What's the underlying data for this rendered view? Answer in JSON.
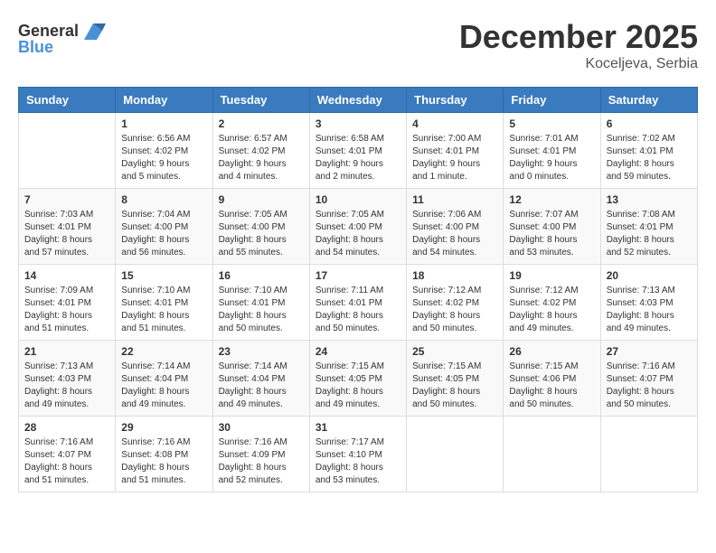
{
  "logo": {
    "general": "General",
    "blue": "Blue"
  },
  "title": {
    "month": "December 2025",
    "location": "Koceljeva, Serbia"
  },
  "weekdays": [
    "Sunday",
    "Monday",
    "Tuesday",
    "Wednesday",
    "Thursday",
    "Friday",
    "Saturday"
  ],
  "weeks": [
    [
      {
        "day": "",
        "sunrise": "",
        "sunset": "",
        "daylight": ""
      },
      {
        "day": "1",
        "sunrise": "Sunrise: 6:56 AM",
        "sunset": "Sunset: 4:02 PM",
        "daylight": "Daylight: 9 hours and 5 minutes."
      },
      {
        "day": "2",
        "sunrise": "Sunrise: 6:57 AM",
        "sunset": "Sunset: 4:02 PM",
        "daylight": "Daylight: 9 hours and 4 minutes."
      },
      {
        "day": "3",
        "sunrise": "Sunrise: 6:58 AM",
        "sunset": "Sunset: 4:01 PM",
        "daylight": "Daylight: 9 hours and 2 minutes."
      },
      {
        "day": "4",
        "sunrise": "Sunrise: 7:00 AM",
        "sunset": "Sunset: 4:01 PM",
        "daylight": "Daylight: 9 hours and 1 minute."
      },
      {
        "day": "5",
        "sunrise": "Sunrise: 7:01 AM",
        "sunset": "Sunset: 4:01 PM",
        "daylight": "Daylight: 9 hours and 0 minutes."
      },
      {
        "day": "6",
        "sunrise": "Sunrise: 7:02 AM",
        "sunset": "Sunset: 4:01 PM",
        "daylight": "Daylight: 8 hours and 59 minutes."
      }
    ],
    [
      {
        "day": "7",
        "sunrise": "Sunrise: 7:03 AM",
        "sunset": "Sunset: 4:01 PM",
        "daylight": "Daylight: 8 hours and 57 minutes."
      },
      {
        "day": "8",
        "sunrise": "Sunrise: 7:04 AM",
        "sunset": "Sunset: 4:00 PM",
        "daylight": "Daylight: 8 hours and 56 minutes."
      },
      {
        "day": "9",
        "sunrise": "Sunrise: 7:05 AM",
        "sunset": "Sunset: 4:00 PM",
        "daylight": "Daylight: 8 hours and 55 minutes."
      },
      {
        "day": "10",
        "sunrise": "Sunrise: 7:05 AM",
        "sunset": "Sunset: 4:00 PM",
        "daylight": "Daylight: 8 hours and 54 minutes."
      },
      {
        "day": "11",
        "sunrise": "Sunrise: 7:06 AM",
        "sunset": "Sunset: 4:00 PM",
        "daylight": "Daylight: 8 hours and 54 minutes."
      },
      {
        "day": "12",
        "sunrise": "Sunrise: 7:07 AM",
        "sunset": "Sunset: 4:00 PM",
        "daylight": "Daylight: 8 hours and 53 minutes."
      },
      {
        "day": "13",
        "sunrise": "Sunrise: 7:08 AM",
        "sunset": "Sunset: 4:01 PM",
        "daylight": "Daylight: 8 hours and 52 minutes."
      }
    ],
    [
      {
        "day": "14",
        "sunrise": "Sunrise: 7:09 AM",
        "sunset": "Sunset: 4:01 PM",
        "daylight": "Daylight: 8 hours and 51 minutes."
      },
      {
        "day": "15",
        "sunrise": "Sunrise: 7:10 AM",
        "sunset": "Sunset: 4:01 PM",
        "daylight": "Daylight: 8 hours and 51 minutes."
      },
      {
        "day": "16",
        "sunrise": "Sunrise: 7:10 AM",
        "sunset": "Sunset: 4:01 PM",
        "daylight": "Daylight: 8 hours and 50 minutes."
      },
      {
        "day": "17",
        "sunrise": "Sunrise: 7:11 AM",
        "sunset": "Sunset: 4:01 PM",
        "daylight": "Daylight: 8 hours and 50 minutes."
      },
      {
        "day": "18",
        "sunrise": "Sunrise: 7:12 AM",
        "sunset": "Sunset: 4:02 PM",
        "daylight": "Daylight: 8 hours and 50 minutes."
      },
      {
        "day": "19",
        "sunrise": "Sunrise: 7:12 AM",
        "sunset": "Sunset: 4:02 PM",
        "daylight": "Daylight: 8 hours and 49 minutes."
      },
      {
        "day": "20",
        "sunrise": "Sunrise: 7:13 AM",
        "sunset": "Sunset: 4:03 PM",
        "daylight": "Daylight: 8 hours and 49 minutes."
      }
    ],
    [
      {
        "day": "21",
        "sunrise": "Sunrise: 7:13 AM",
        "sunset": "Sunset: 4:03 PM",
        "daylight": "Daylight: 8 hours and 49 minutes."
      },
      {
        "day": "22",
        "sunrise": "Sunrise: 7:14 AM",
        "sunset": "Sunset: 4:04 PM",
        "daylight": "Daylight: 8 hours and 49 minutes."
      },
      {
        "day": "23",
        "sunrise": "Sunrise: 7:14 AM",
        "sunset": "Sunset: 4:04 PM",
        "daylight": "Daylight: 8 hours and 49 minutes."
      },
      {
        "day": "24",
        "sunrise": "Sunrise: 7:15 AM",
        "sunset": "Sunset: 4:05 PM",
        "daylight": "Daylight: 8 hours and 49 minutes."
      },
      {
        "day": "25",
        "sunrise": "Sunrise: 7:15 AM",
        "sunset": "Sunset: 4:05 PM",
        "daylight": "Daylight: 8 hours and 50 minutes."
      },
      {
        "day": "26",
        "sunrise": "Sunrise: 7:15 AM",
        "sunset": "Sunset: 4:06 PM",
        "daylight": "Daylight: 8 hours and 50 minutes."
      },
      {
        "day": "27",
        "sunrise": "Sunrise: 7:16 AM",
        "sunset": "Sunset: 4:07 PM",
        "daylight": "Daylight: 8 hours and 50 minutes."
      }
    ],
    [
      {
        "day": "28",
        "sunrise": "Sunrise: 7:16 AM",
        "sunset": "Sunset: 4:07 PM",
        "daylight": "Daylight: 8 hours and 51 minutes."
      },
      {
        "day": "29",
        "sunrise": "Sunrise: 7:16 AM",
        "sunset": "Sunset: 4:08 PM",
        "daylight": "Daylight: 8 hours and 51 minutes."
      },
      {
        "day": "30",
        "sunrise": "Sunrise: 7:16 AM",
        "sunset": "Sunset: 4:09 PM",
        "daylight": "Daylight: 8 hours and 52 minutes."
      },
      {
        "day": "31",
        "sunrise": "Sunrise: 7:17 AM",
        "sunset": "Sunset: 4:10 PM",
        "daylight": "Daylight: 8 hours and 53 minutes."
      },
      {
        "day": "",
        "sunrise": "",
        "sunset": "",
        "daylight": ""
      },
      {
        "day": "",
        "sunrise": "",
        "sunset": "",
        "daylight": ""
      },
      {
        "day": "",
        "sunrise": "",
        "sunset": "",
        "daylight": ""
      }
    ]
  ]
}
